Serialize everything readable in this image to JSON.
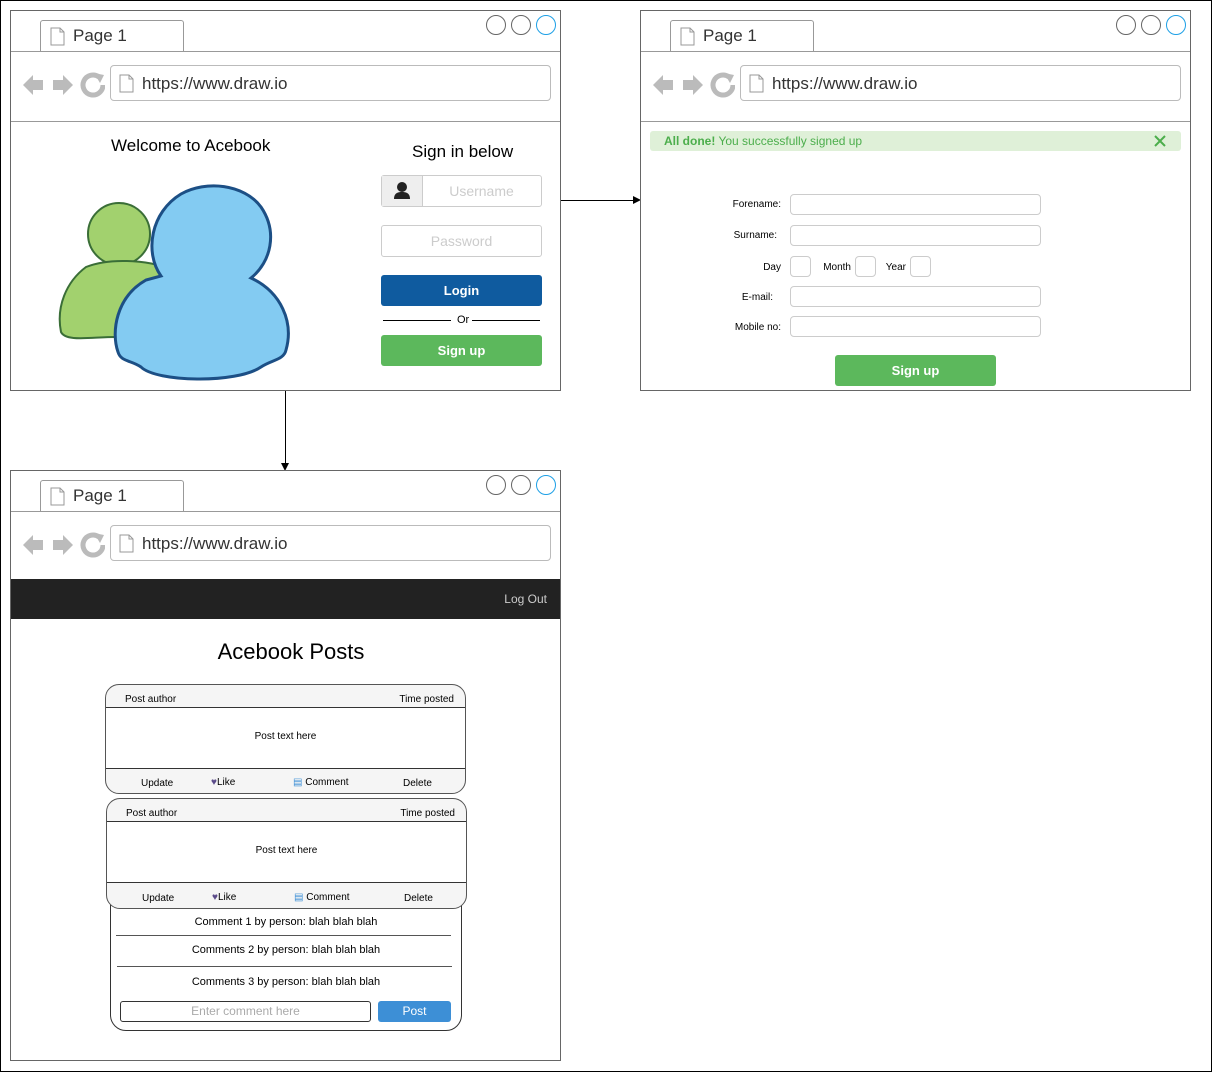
{
  "browser": {
    "tab_label": "Page 1",
    "url": "https://www.draw.io"
  },
  "login_page": {
    "welcome": "Welcome to Acebook",
    "sign_in_title": "Sign in below",
    "username_placeholder": "Username",
    "password_placeholder": "Password",
    "login_label": "Login",
    "or_label": "Or",
    "signup_label": "Sign up"
  },
  "signup_page": {
    "alert_strong": "All done!",
    "alert_text": " You successfully signed up",
    "forename_label": "Forename:",
    "surname_label": "Surname:",
    "day_label": "Day",
    "month_label": "Month",
    "year_label": "Year",
    "email_label": "E-mail:",
    "mobile_label": "Mobile no:",
    "signup_label": "Sign up"
  },
  "posts_page": {
    "logout_label": "Log Out",
    "title": "Acebook Posts",
    "posts": [
      {
        "author": "Post author",
        "time": "Time posted",
        "text": "Post text here",
        "update": "Update",
        "like": "Like",
        "comment": "Comment",
        "delete": "Delete"
      },
      {
        "author": "Post author",
        "time": "Time posted",
        "text": "Post text here",
        "update": "Update",
        "like": "Like",
        "comment": "Comment",
        "delete": "Delete"
      }
    ],
    "comments": [
      "Comment 1 by person: blah blah blah",
      "Comments 2 by person: blah blah blah",
      "Comments 3 by person: blah blah blah"
    ],
    "comment_placeholder": "Enter comment here",
    "post_button": "Post"
  },
  "colors": {
    "login_blue": "#0f5b9f",
    "signup_green": "#5cb85c",
    "alert_bg": "#dff0d8",
    "alert_text": "#4cae4c",
    "header_dark": "#222222",
    "post_blue": "#3d8fd6",
    "user_green": "#a2d16e",
    "user_blue": "#83cbf2"
  },
  "icons": [
    "page-icon",
    "back-arrow-icon",
    "forward-arrow-icon",
    "reload-icon",
    "user-icon",
    "close-icon",
    "heart-icon",
    "comment-icon",
    "users-illustration"
  ]
}
